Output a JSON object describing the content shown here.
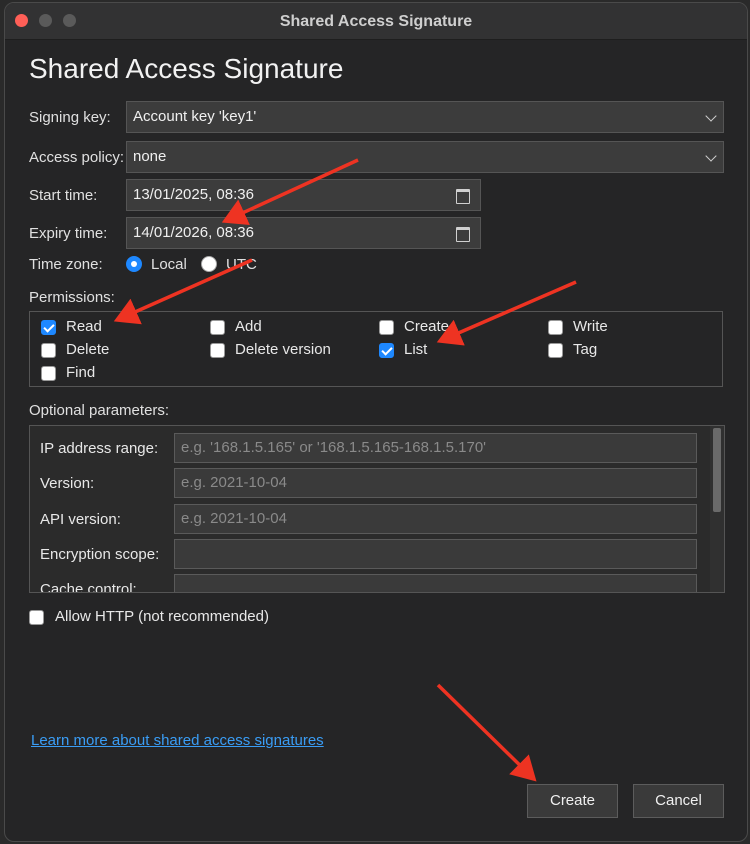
{
  "window": {
    "title": "Shared Access Signature"
  },
  "dialog": {
    "heading": "Shared Access Signature"
  },
  "form": {
    "signing_key": {
      "label": "Signing key:",
      "value": "Account key 'key1'"
    },
    "access_policy": {
      "label": "Access policy:",
      "value": "none"
    },
    "start_time": {
      "label": "Start time:",
      "value": "13/01/2025, 08:36"
    },
    "expiry_time": {
      "label": "Expiry time:",
      "value": "14/01/2026, 08:36"
    },
    "time_zone": {
      "label": "Time zone:",
      "options": [
        "Local",
        "UTC"
      ],
      "selected": "Local"
    }
  },
  "permissions": {
    "label": "Permissions:",
    "items": [
      {
        "label": "Read",
        "checked": true
      },
      {
        "label": "Add",
        "checked": false
      },
      {
        "label": "Create",
        "checked": false
      },
      {
        "label": "Write",
        "checked": false
      },
      {
        "label": "Delete",
        "checked": false
      },
      {
        "label": "Delete version",
        "checked": false
      },
      {
        "label": "List",
        "checked": true
      },
      {
        "label": "Tag",
        "checked": false
      },
      {
        "label": "Find",
        "checked": false
      }
    ]
  },
  "optional": {
    "label": "Optional parameters:",
    "fields": [
      {
        "label": "IP address range:",
        "placeholder": "e.g. '168.1.5.165' or '168.1.5.165-168.1.5.170'"
      },
      {
        "label": "Version:",
        "placeholder": "e.g. 2021-10-04"
      },
      {
        "label": "API version:",
        "placeholder": "e.g. 2021-10-04"
      },
      {
        "label": "Encryption scope:",
        "placeholder": ""
      },
      {
        "label": "Cache control:",
        "placeholder": ""
      }
    ]
  },
  "allow_http": {
    "label": "Allow HTTP (not recommended)",
    "checked": false
  },
  "learn_more": "Learn more about shared access signatures",
  "buttons": {
    "create": "Create",
    "cancel": "Cancel"
  },
  "colors": {
    "accent": "#1e88ff",
    "link": "#3a9df5",
    "annotation_arrow": "#ee3322"
  }
}
